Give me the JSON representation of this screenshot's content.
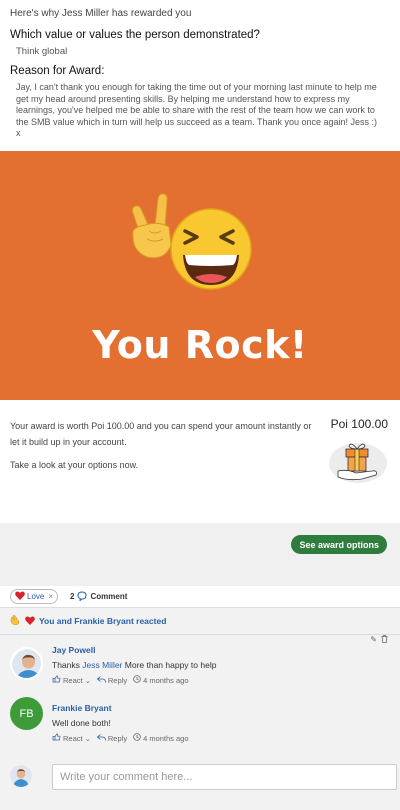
{
  "award_message": {
    "intro": "Here's why Jess Miller has rewarded you",
    "values_question": "Which value or values the person demonstrated?",
    "value": "Think global",
    "reason_heading": "Reason for Award:",
    "reason_text": "Jay, I can't thank you enough for taking the time out of your morning last minute to help me get my head around presenting skills. By helping me understand how to express my learnings, you've helped me be able to share with the rest of the team how we can work to the SMB value which in turn will help us succeed as a team. Thank you once again! Jess :) x"
  },
  "banner": {
    "title": "You Rock!",
    "background_color": "#e36f31",
    "icon": "rock-on-laughing-emoji"
  },
  "award": {
    "worth_text": "Your award is worth Poi 100.00 and you can spend your amount instantly or let it build up in your account.",
    "options_text": "Take a look at your options now.",
    "amount": "Poi 100.00",
    "icon": "gift-in-hand-icon",
    "button_label": "See award options",
    "button_color": "#2e7d3e"
  },
  "reactions": {
    "love_label": "Love",
    "love_remove": "×",
    "comment_count": "2",
    "comment_label": "Comment",
    "summary": "You and Frankie Bryant reacted"
  },
  "comments": [
    {
      "author": "Jay Powell",
      "text_before": "Thanks ",
      "mention": "Jess Miller",
      "text_after": " More than happy to help",
      "react_label": "React",
      "reply_label": "Reply",
      "time": "4 months ago"
    },
    {
      "author": "Frankie Bryant",
      "initials": "FB",
      "avatar_color": "#3e9b3a",
      "text": "Well done both!",
      "react_label": "React",
      "reply_label": "Reply",
      "time": "4 months ago"
    }
  ],
  "composer": {
    "placeholder": "Write your comment here..."
  }
}
